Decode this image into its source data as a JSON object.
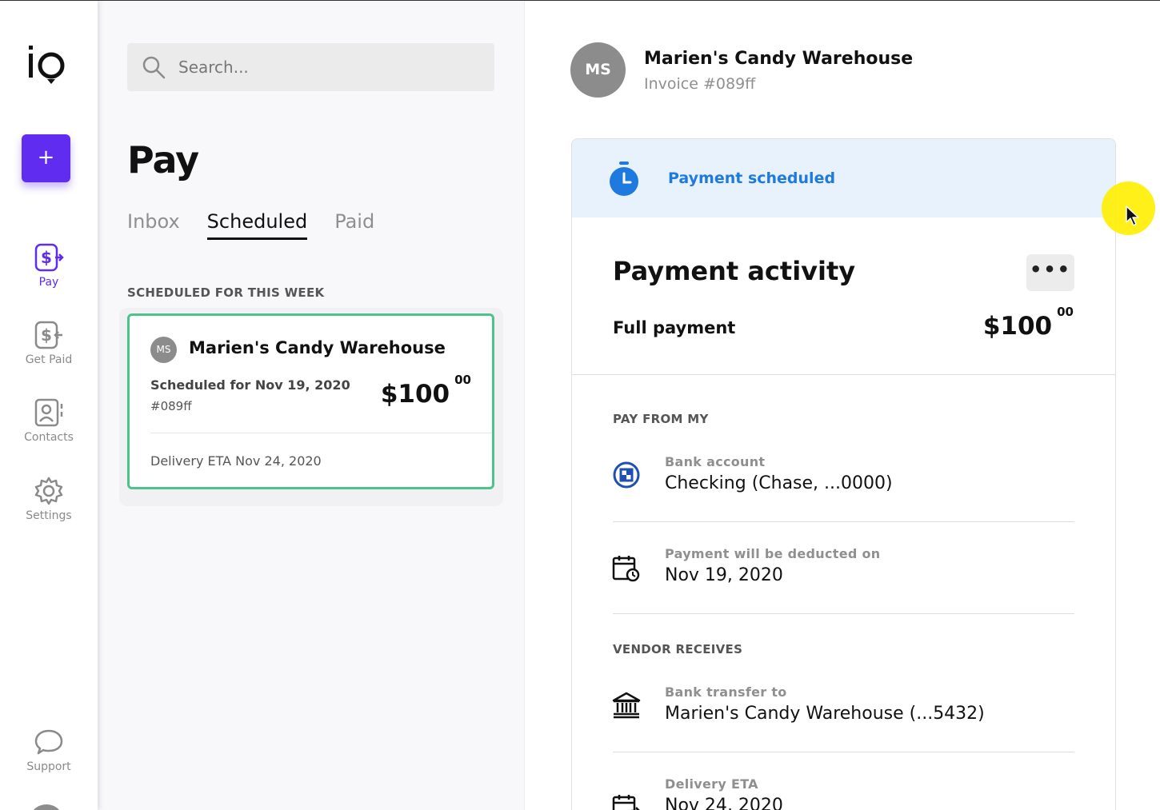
{
  "nav": {
    "add_label": "+",
    "items": [
      {
        "label": "Pay",
        "icon": "pay-dollar-icon",
        "active": true
      },
      {
        "label": "Get Paid",
        "icon": "get-paid-dollar-icon",
        "active": false
      },
      {
        "label": "Contacts",
        "icon": "contacts-icon",
        "active": false
      },
      {
        "label": "Settings",
        "icon": "gear-icon",
        "active": false
      }
    ],
    "support_label": "Support"
  },
  "list": {
    "search_placeholder": "Search...",
    "title": "Pay",
    "tabs": [
      {
        "label": "Inbox",
        "active": false
      },
      {
        "label": "Scheduled",
        "active": true
      },
      {
        "label": "Paid",
        "active": false
      }
    ],
    "section_label": "SCHEDULED FOR THIS WEEK",
    "card": {
      "initials": "MS",
      "name": "Marien's Candy Warehouse",
      "scheduled": "Scheduled for Nov 19, 2020",
      "number": "#089ff",
      "amount_main": "$100",
      "amount_cents": "00",
      "delivery": "Delivery ETA Nov 24, 2020"
    }
  },
  "detail": {
    "initials": "MS",
    "vendor_name": "Marien's Candy Warehouse",
    "invoice": "Invoice #089ff",
    "banner_text": "Payment scheduled",
    "activity_title": "Payment activity",
    "more_label": "•••",
    "full_payment_label": "Full payment",
    "amount_main": "$100",
    "amount_cents": "00",
    "pay_from_label": "PAY FROM MY",
    "bank_caption": "Bank account",
    "bank_value": "Checking (Chase, ...0000)",
    "deduct_caption": "Payment will be deducted on",
    "deduct_value": "Nov 19, 2020",
    "vendor_receives_label": "VENDOR RECEIVES",
    "transfer_caption": "Bank transfer to",
    "transfer_value": "Marien's Candy Warehouse (...5432)",
    "eta_caption": "Delivery ETA",
    "eta_value": "Nov 24, 2020"
  },
  "colors": {
    "accent": "#5f2cf0",
    "card_border": "#4cc38a",
    "banner_bg": "#e7f2fc",
    "banner_text": "#1f7ae0",
    "cursor_highlight": "#ffee00"
  }
}
